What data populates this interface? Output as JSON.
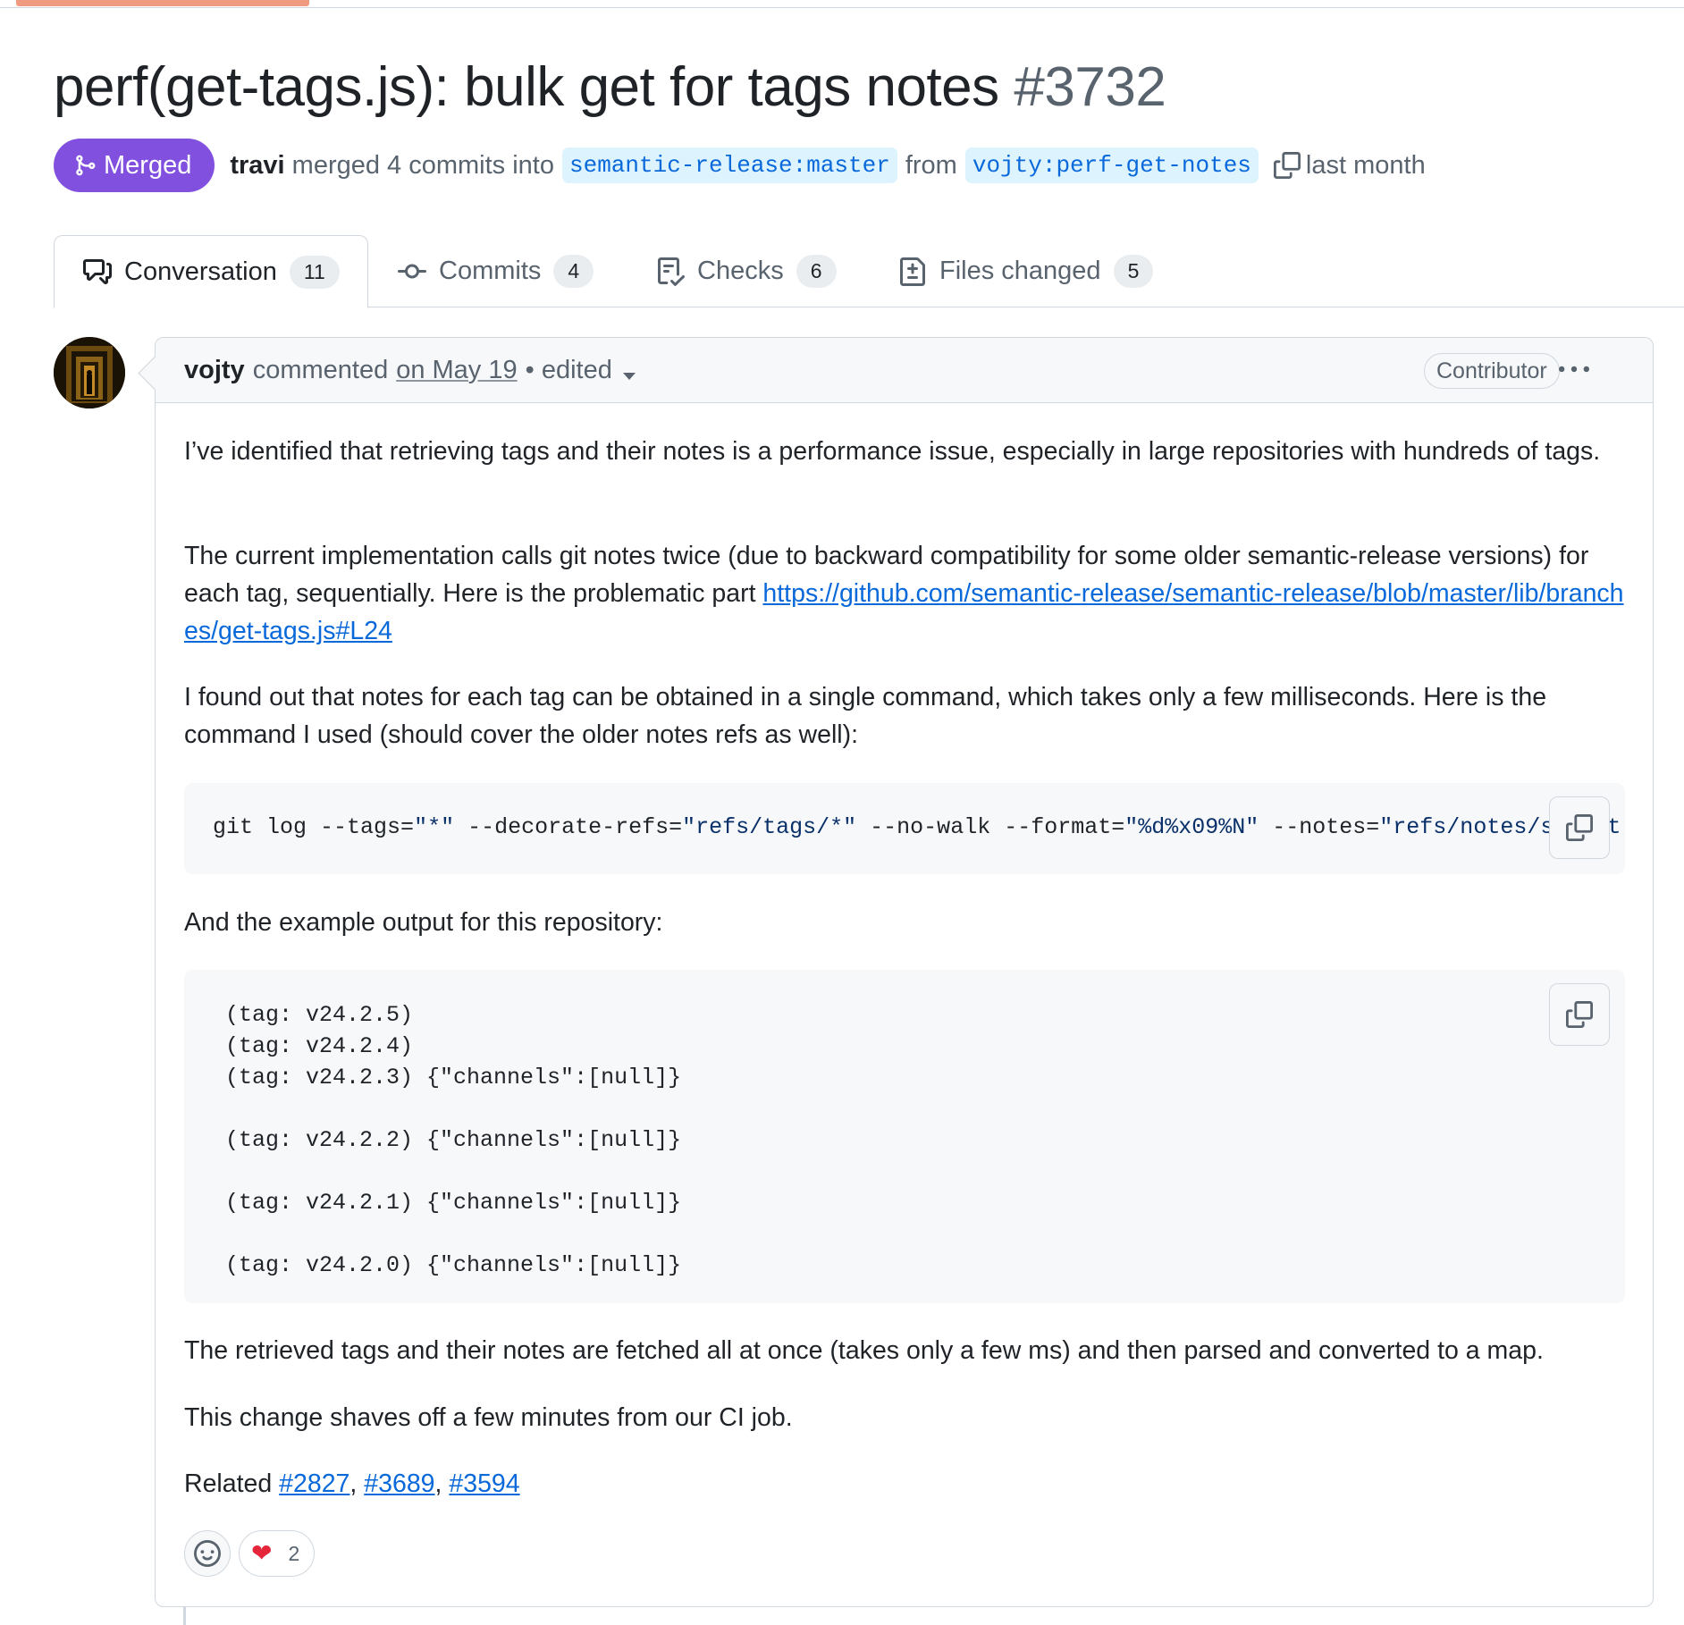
{
  "pr": {
    "title": "perf(get-tags.js): bulk get for tags notes",
    "number": "#3732",
    "state": "Merged",
    "merged_by": "travi",
    "merge_text": "merged 4 commits into",
    "base_branch": "semantic-release:master",
    "from_text": "from",
    "head_branch": "vojty:perf-get-notes",
    "merged_when": "last month"
  },
  "tabs": [
    {
      "label": "Conversation",
      "count": "11",
      "active": true
    },
    {
      "label": "Commits",
      "count": "4"
    },
    {
      "label": "Checks",
      "count": "6"
    },
    {
      "label": "Files changed",
      "count": "5"
    }
  ],
  "comment": {
    "author": "vojty",
    "action": "commented",
    "date": "on May 19",
    "separator": "•",
    "edited": "edited",
    "role": "Contributor",
    "paragraphs": {
      "p1": "I’ve identified that retrieving tags and their notes is a performance issue, especially in large repositories with hundreds of tags.",
      "p2_before": "The current implementation calls git notes twice (due to backward compatibility for some older semantic-release versions) for each tag, sequentially. Here is the problematic part ",
      "p2_link": "https://github.com/semantic-release/semantic-release/blob/master/lib/branches/get-tags.js#L24",
      "p3": "I found out that notes for each tag can be obtained in a single command, which takes only a few milliseconds. Here is the command I used (should cover the older notes refs as well):",
      "p4": "And the example output for this repository:",
      "p5": "The retrieved tags and their notes are fetched all at once (takes only a few ms) and then parsed and converted to a map.",
      "p6": "This change shaves off a few minutes from our CI job.",
      "related_label": "Related",
      "related_links": [
        "#2827",
        "#3689",
        "#3594"
      ],
      "related_separator": ", "
    },
    "command": {
      "git": "git log ",
      "tags_flag": "--tags=",
      "tags_val": "\"*\"",
      "decorate_flag": " --decorate-refs=",
      "decorate_val": "\"refs/tags/*\"",
      "nowalk_flag": " --no-walk --format=",
      "format_val": "\"%d%x09%N\"",
      "notes_flag": " --notes=",
      "notes_val": "\"refs/notes/semant"
    },
    "output_lines": [
      "(tag: v24.2.5)",
      "(tag: v24.2.4)",
      "(tag: v24.2.3) {\"channels\":[null]}",
      "",
      "(tag: v24.2.2) {\"channels\":[null]}",
      "",
      "(tag: v24.2.1) {\"channels\":[null]}",
      "",
      "(tag: v24.2.0) {\"channels\":[null]}"
    ],
    "reactions": {
      "heart_count": "2"
    }
  },
  "icons": {
    "merged": "git-merge-icon",
    "copy": "copy-icon",
    "conversation": "comment-discussion-icon",
    "commits": "git-commit-icon",
    "checks": "checklist-icon",
    "files": "file-diff-icon",
    "kebab": "kebab-horizontal-icon",
    "smiley": "smiley-icon",
    "heart": "heart-emoji"
  },
  "colors": {
    "merged_badge": "#8250df",
    "link": "#0969da",
    "branch_bg": "#ddf4ff",
    "muted": "#59636e",
    "border": "#d0d7de"
  }
}
